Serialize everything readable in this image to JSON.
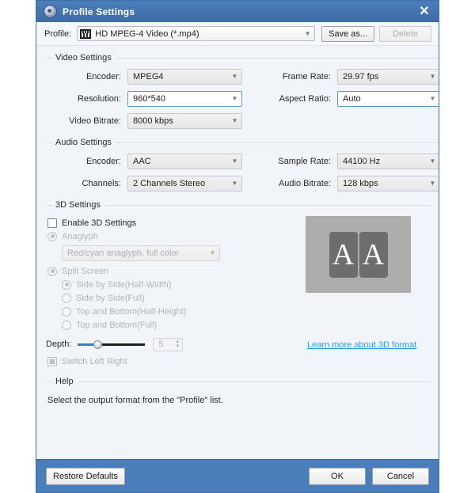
{
  "window": {
    "title": "Profile Settings",
    "icon": "disc-icon",
    "close_label": "✕"
  },
  "profile_bar": {
    "label": "Profile:",
    "icon": "video-file-icon",
    "value": "HD MPEG-4 Video (*.mp4)",
    "save_as_label": "Save as...",
    "delete_label": "Delete"
  },
  "video_settings": {
    "title": "Video Settings",
    "encoder": {
      "label": "Encoder:",
      "value": "MPEG4"
    },
    "frame_rate": {
      "label": "Frame Rate:",
      "value": "29.97 fps"
    },
    "resolution": {
      "label": "Resolution:",
      "value": "960*540"
    },
    "aspect_ratio": {
      "label": "Aspect Ratio:",
      "value": "Auto"
    },
    "video_bitrate": {
      "label": "Video Bitrate:",
      "value": "8000 kbps"
    }
  },
  "audio_settings": {
    "title": "Audio Settings",
    "encoder": {
      "label": "Encoder:",
      "value": "AAC"
    },
    "sample_rate": {
      "label": "Sample Rate:",
      "value": "44100 Hz"
    },
    "channels": {
      "label": "Channels:",
      "value": "2 Channels Stereo"
    },
    "audio_bitrate": {
      "label": "Audio Bitrate:",
      "value": "128 kbps"
    }
  },
  "three_d_settings": {
    "title": "3D Settings",
    "enable_label": "Enable 3D Settings",
    "anaglyph_label": "Anaglyph",
    "anaglyph_value": "Red/cyan anaglyph, full color",
    "split_screen_label": "Split Screen",
    "split_options": [
      "Side by Side(Half-Width)",
      "Side by Side(Full)",
      "Top and Bottom(Half-Height)",
      "Top and Bottom(Full)"
    ],
    "depth_label": "Depth:",
    "depth_value": "5",
    "switch_left_right_label": "Switch Left Right",
    "preview_glyph_left": "A",
    "preview_glyph_right": "A",
    "learn_more_label": "Learn more about 3D format"
  },
  "help": {
    "title": "Help",
    "text": "Select the output format from the \"Profile\" list."
  },
  "footer": {
    "restore_label": "Restore Defaults",
    "ok_label": "OK",
    "cancel_label": "Cancel"
  },
  "colors": {
    "titlebar": "#4a7ebb",
    "footer": "#4a7ebb",
    "link": "#1f9ef0",
    "slider_active": "#2f82d8",
    "focus_border": "#5b9bb5"
  }
}
